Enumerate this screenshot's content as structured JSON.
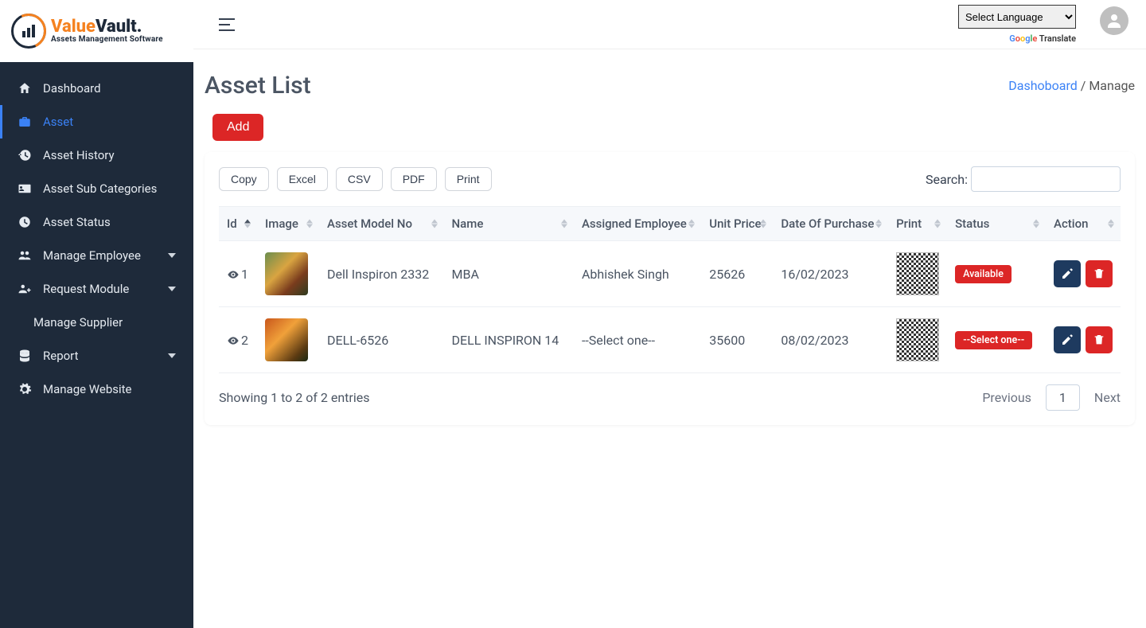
{
  "brand": {
    "name1": "Value",
    "name2": "Vault.",
    "tag": "Assets Management Software"
  },
  "language": {
    "selected": "Select Language",
    "translate": "Translate"
  },
  "sidebar": {
    "items": [
      {
        "label": "Dashboard",
        "icon": "home"
      },
      {
        "label": "Asset",
        "icon": "briefcase",
        "active": true
      },
      {
        "label": "Asset History",
        "icon": "history"
      },
      {
        "label": "Asset Sub Categories",
        "icon": "id-card"
      },
      {
        "label": "Asset Status",
        "icon": "clock"
      },
      {
        "label": "Manage Employee",
        "icon": "users",
        "caret": true
      },
      {
        "label": "Request Module",
        "icon": "user-plus",
        "caret": true
      },
      {
        "label": "Manage Supplier",
        "icon": ""
      },
      {
        "label": "Report",
        "icon": "database",
        "caret": true
      },
      {
        "label": "Manage Website",
        "icon": "gear"
      }
    ]
  },
  "page": {
    "title": "Asset List",
    "crumb_root": "Dashoboard",
    "crumb_sep": " / ",
    "crumb_current": "Manage",
    "add_label": "Add"
  },
  "datatable": {
    "buttons": [
      "Copy",
      "Excel",
      "CSV",
      "PDF",
      "Print"
    ],
    "search_label": "Search:",
    "columns": [
      "Id",
      "Image",
      "Asset Model No",
      "Name",
      "Assigned Employee",
      "Unit Price",
      "Date Of Purchase",
      "Print",
      "Status",
      "Action"
    ],
    "rows": [
      {
        "id": "1",
        "model": "Dell Inspiron 2332",
        "name": "MBA",
        "employee": "Abhishek Singh",
        "price": "25626",
        "date": "16/02/2023",
        "status": "Available"
      },
      {
        "id": "2",
        "model": "DELL-6526",
        "name": "DELL INSPIRON 14",
        "employee": "--Select one--",
        "price": "35600",
        "date": "08/02/2023",
        "status": "--Select one--"
      }
    ],
    "info": "Showing 1 to 2 of 2 entries",
    "prev": "Previous",
    "next": "Next",
    "page": "1"
  }
}
